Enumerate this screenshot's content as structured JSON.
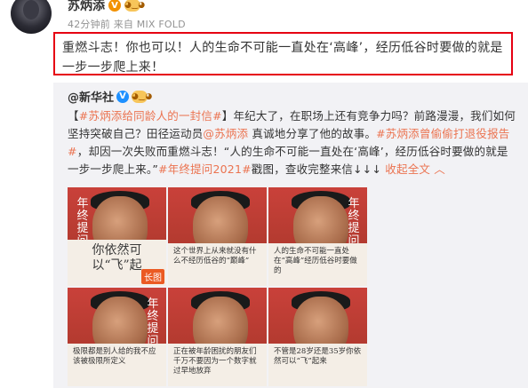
{
  "post": {
    "username": "苏炳添",
    "meta": "42分钟前 来自 MIX FOLD",
    "text": "重燃斗志！你也可以！人的生命不可能一直处在‘高峰’，经历低谷时要做的就是一步一步爬上来！"
  },
  "repost": {
    "source": "@新华社",
    "segments": [
      {
        "t": "【",
        "type": "text"
      },
      {
        "t": "#苏炳添给同龄人的一封信#",
        "type": "tag"
      },
      {
        "t": "】年纪大了，在职场上还有竞争力吗？前路漫漫，我们如何坚持突破自己？田径运动员",
        "type": "text"
      },
      {
        "t": "@苏炳添",
        "type": "tag"
      },
      {
        "t": " 真诚地分享了他的故事。",
        "type": "text"
      },
      {
        "t": "#苏炳添曾偷偷打退役报告#",
        "type": "tag"
      },
      {
        "t": "，却因一次失败而重燃斗志！“人的生命不可能一直处在‘高峰’，经历低谷时要做的就是一步一步爬上来。”",
        "type": "text"
      },
      {
        "t": "#年终提问2021#",
        "type": "tag"
      },
      {
        "t": "戳图，查收完整来信↓↓↓ ",
        "type": "text"
      },
      {
        "t": "收起全文",
        "type": "link"
      },
      {
        "t": " ︿",
        "type": "link"
      }
    ]
  },
  "thumbs": [
    {
      "title": "年终提问",
      "caption": "你依然可以“飞”起",
      "big": true,
      "badge": "长图"
    },
    {
      "title": "",
      "caption": "这个世界上从来就没有什么不经历低谷的“巅峰”",
      "big": false
    },
    {
      "title": "年终提问",
      "caption": "人的生命不可能一直处在“高峰”经历低谷时要做的",
      "big": false
    },
    {
      "title": "年终提问",
      "caption": "极限都是别人给的我不应该被极限所定义",
      "big": false
    },
    {
      "title": "",
      "caption": "正在被年龄困扰的朋友们千万不要因为一个数字就过早地放弃",
      "big": false
    },
    {
      "title": "",
      "caption": "不管是28岁还是35岁你依然可以“飞”起来",
      "big": false
    }
  ]
}
